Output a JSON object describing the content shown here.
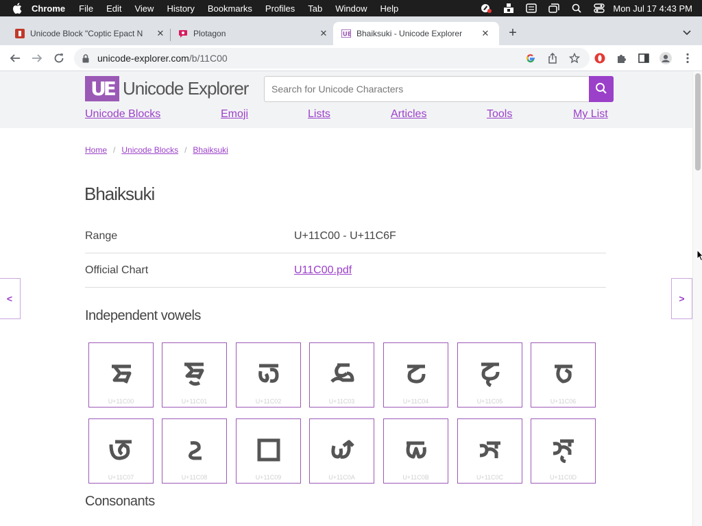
{
  "menubar": {
    "app_name": "Chrome",
    "items": [
      "File",
      "Edit",
      "View",
      "History",
      "Bookmarks",
      "Profiles",
      "Tab",
      "Window",
      "Help"
    ],
    "clock": "Mon Jul 17  4:43 PM"
  },
  "tabs": [
    {
      "title": "Unicode Block \"Coptic Epact N",
      "icon": "letter-i-icon",
      "active": false
    },
    {
      "title": "Plotagon",
      "icon": "plotagon-icon",
      "active": false
    },
    {
      "title": "Bhaiksuki - Unicode Explorer",
      "icon": "unicode-explorer-icon",
      "active": true
    }
  ],
  "toolbar": {
    "url_domain": "unicode-explorer.com",
    "url_path": "/b/11C00"
  },
  "site": {
    "logo_mark": "UE",
    "logo_text": "Unicode Explorer",
    "search_placeholder": "Search for Unicode Characters",
    "nav": [
      "Unicode Blocks",
      "Emoji",
      "Lists",
      "Articles",
      "Tools",
      "My List"
    ]
  },
  "breadcrumb": [
    "Home",
    "Unicode Blocks",
    "Bhaiksuki"
  ],
  "page": {
    "title": "Bhaiksuki",
    "info": [
      {
        "label": "Range",
        "value": "U+11C00 - U+11C6F",
        "link": false
      },
      {
        "label": "Official Chart",
        "value": "U11C00.pdf",
        "link": true
      }
    ],
    "sections": [
      "Independent vowels",
      "Consonants"
    ],
    "prev_label": "<",
    "next_label": ">"
  },
  "characters": [
    {
      "glyph": "𑰀",
      "code": "U+11C00"
    },
    {
      "glyph": "𑰁",
      "code": "U+11C01"
    },
    {
      "glyph": "𑰂",
      "code": "U+11C02"
    },
    {
      "glyph": "𑰃",
      "code": "U+11C03"
    },
    {
      "glyph": "𑰄",
      "code": "U+11C04"
    },
    {
      "glyph": "𑰅",
      "code": "U+11C05"
    },
    {
      "glyph": "𑰆",
      "code": "U+11C06"
    },
    {
      "glyph": "𑰇",
      "code": "U+11C07"
    },
    {
      "glyph": "𑰈",
      "code": "U+11C08"
    },
    {
      "glyph": "𑰉",
      "code": "U+11C09"
    },
    {
      "glyph": "𑰊",
      "code": "U+11C0A"
    },
    {
      "glyph": "𑰋",
      "code": "U+11C0B"
    },
    {
      "glyph": "𑰌",
      "code": "U+11C0C"
    },
    {
      "glyph": "𑰍",
      "code": "U+11C0D"
    }
  ],
  "colors": {
    "accent": "#9b40c9",
    "cell_border": "#9b59b6",
    "header_bg": "#f2f3f5"
  }
}
